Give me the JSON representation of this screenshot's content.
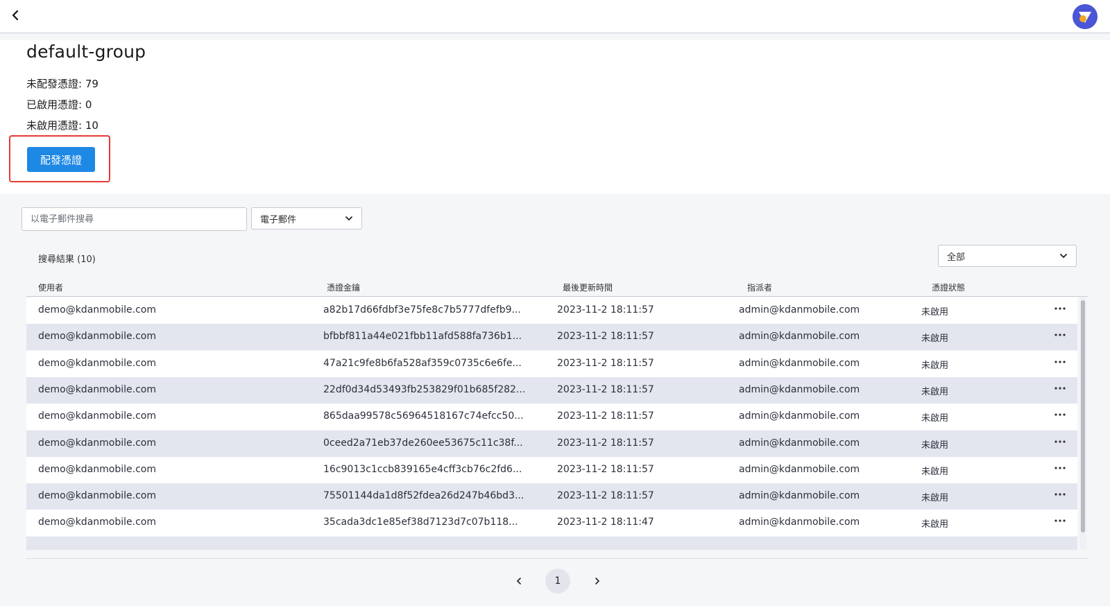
{
  "header": {
    "back_icon": "chevron-left-icon",
    "avatar_icon": "app-logo-avatar"
  },
  "group": {
    "title": "default-group",
    "stats": [
      "未配發憑證: 79",
      "已啟用憑證: 0",
      "未啟用憑證: 10"
    ],
    "assign_button": "配發憑證"
  },
  "filters": {
    "search_placeholder": "以電子郵件搜尋",
    "field_select": "電子郵件",
    "status_select": "全部"
  },
  "results": {
    "label": "搜尋結果 (10)"
  },
  "table": {
    "columns": [
      "使用者",
      "憑證金鑰",
      "最後更新時間",
      "指派者",
      "憑證狀態"
    ],
    "rows": [
      {
        "user": "demo@kdanmobile.com",
        "key": "a82b17d66fdbf3e75fe8c7b5777dfefb9...",
        "time": "2023-11-2 18:11:57",
        "assigner": "admin@kdanmobile.com",
        "status": "未啟用"
      },
      {
        "user": "demo@kdanmobile.com",
        "key": "bfbbf811a44e021fbb11afd588fa736b1...",
        "time": "2023-11-2 18:11:57",
        "assigner": "admin@kdanmobile.com",
        "status": "未啟用"
      },
      {
        "user": "demo@kdanmobile.com",
        "key": "47a21c9fe8b6fa528af359c0735c6e6fe...",
        "time": "2023-11-2 18:11:57",
        "assigner": "admin@kdanmobile.com",
        "status": "未啟用"
      },
      {
        "user": "demo@kdanmobile.com",
        "key": "22df0d34d53493fb253829f01b685f282...",
        "time": "2023-11-2 18:11:57",
        "assigner": "admin@kdanmobile.com",
        "status": "未啟用"
      },
      {
        "user": "demo@kdanmobile.com",
        "key": "865daa99578c56964518167c74efcc50...",
        "time": "2023-11-2 18:11:57",
        "assigner": "admin@kdanmobile.com",
        "status": "未啟用"
      },
      {
        "user": "demo@kdanmobile.com",
        "key": "0ceed2a71eb37de260ee53675c11c38f...",
        "time": "2023-11-2 18:11:57",
        "assigner": "admin@kdanmobile.com",
        "status": "未啟用"
      },
      {
        "user": "demo@kdanmobile.com",
        "key": "16c9013c1ccb839165e4cff3cb76c2fd6...",
        "time": "2023-11-2 18:11:57",
        "assigner": "admin@kdanmobile.com",
        "status": "未啟用"
      },
      {
        "user": "demo@kdanmobile.com",
        "key": "75501144da1d8f52fdea26d247b46bd3...",
        "time": "2023-11-2 18:11:57",
        "assigner": "admin@kdanmobile.com",
        "status": "未啟用"
      },
      {
        "user": "demo@kdanmobile.com",
        "key": "35cada3dc1e85ef38d7123d7c07b118...",
        "time": "2023-11-2 18:11:47",
        "assigner": "admin@kdanmobile.com",
        "status": "未啟用"
      }
    ]
  },
  "pagination": {
    "current_page": "1"
  },
  "colors": {
    "primary": "#1e88e5",
    "highlight": "#e53935",
    "row_alt": "#e3e5ef"
  }
}
